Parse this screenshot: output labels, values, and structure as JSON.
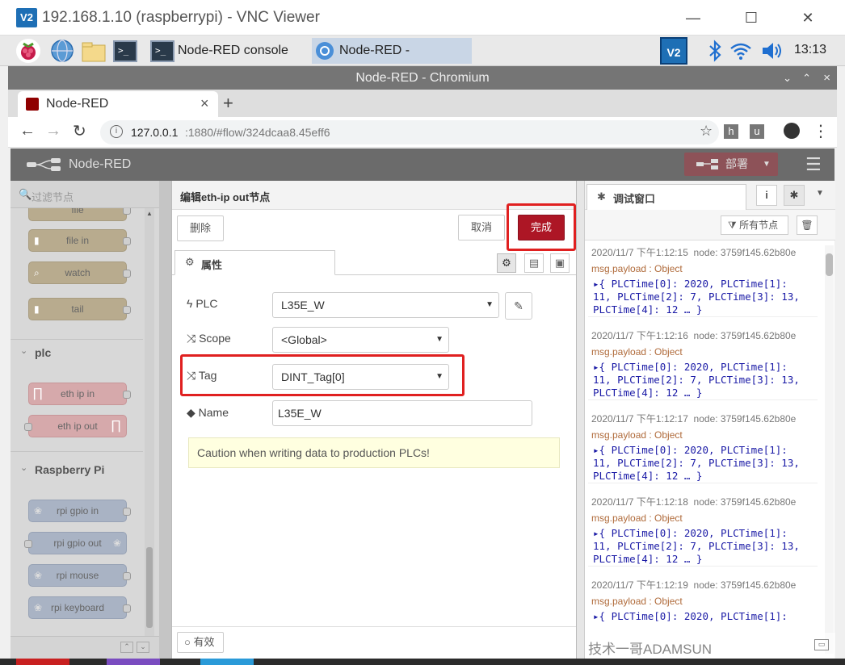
{
  "vnc": {
    "logo": "V2",
    "title": "192.168.1.10 (raspberrypi) - VNC Viewer",
    "minimize": "—",
    "maximize": "☐",
    "close": "✕"
  },
  "taskbar": {
    "tasks": [
      "Node-RED console",
      "Node-RED - Chromium"
    ],
    "tray_vnc": "V2",
    "clock": "13:13"
  },
  "chrome": {
    "window_title": "Node-RED - Chromium",
    "tab_title": "Node-RED",
    "tab_close": "×",
    "new_tab": "+",
    "url_host": "127.0.0.1",
    "url_rest": ":1880/#flow/324dcaa8.45eff6",
    "ext_h": "h",
    "ext_u": "u",
    "win_controls": [
      "⌄",
      "⌃",
      "×"
    ]
  },
  "nodered": {
    "brand": "Node-RED",
    "deploy_label": "部署",
    "filter_placeholder": "过滤节点",
    "palette": {
      "storage_nodes": [
        "file",
        "file in",
        "watch",
        "tail"
      ],
      "plc_category": "plc",
      "plc_nodes": [
        "eth ip in",
        "eth ip out"
      ],
      "rpi_category": "Raspberry Pi",
      "rpi_nodes": [
        "rpi gpio in",
        "rpi gpio out",
        "rpi mouse",
        "rpi keyboard"
      ]
    },
    "editor": {
      "title": "编辑eth-ip out节点",
      "delete_label": "删除",
      "cancel_label": "取消",
      "done_label": "完成",
      "tab_properties": "属性",
      "fields": {
        "plc_label": "PLC",
        "plc_value": "L35E_W",
        "scope_label": "Scope",
        "scope_value": "<Global>",
        "tag_label": "Tag",
        "tag_value": "DINT_Tag[0]",
        "name_label": "Name",
        "name_value": "L35E_W"
      },
      "caution": "Caution when writing data to production PLCs!",
      "enabled_label": "有效"
    },
    "debug": {
      "tab_title": "调试窗口",
      "filter_label": "所有节点",
      "messages": [
        {
          "time": "2020/11/7 下午1:12:15",
          "node": "node: 3759f145.62b80e",
          "topic": "msg.payload : Object",
          "lines": [
            "▸{ PLCTime[0]: 2020, PLCTime[1]:",
            "11, PLCTime[2]: 7, PLCTime[3]: 13,",
            "PLCTime[4]: 12 … }"
          ]
        },
        {
          "time": "2020/11/7 下午1:12:16",
          "node": "node: 3759f145.62b80e",
          "topic": "msg.payload : Object",
          "lines": [
            "▸{ PLCTime[0]: 2020, PLCTime[1]:",
            "11, PLCTime[2]: 7, PLCTime[3]: 13,",
            "PLCTime[4]: 12 … }"
          ]
        },
        {
          "time": "2020/11/7 下午1:12:17",
          "node": "node: 3759f145.62b80e",
          "topic": "msg.payload : Object",
          "lines": [
            "▸{ PLCTime[0]: 2020, PLCTime[1]:",
            "11, PLCTime[2]: 7, PLCTime[3]: 13,",
            "PLCTime[4]: 12 … }"
          ]
        },
        {
          "time": "2020/11/7 下午1:12:18",
          "node": "node: 3759f145.62b80e",
          "topic": "msg.payload : Object",
          "lines": [
            "▸{ PLCTime[0]: 2020, PLCTime[1]:",
            "11, PLCTime[2]: 7, PLCTime[3]: 13,",
            "PLCTime[4]: 12 … }"
          ]
        },
        {
          "time": "2020/11/7 下午1:12:19",
          "node": "node: 3759f145.62b80e",
          "topic": "msg.payload : Object",
          "lines": [
            "▸{ PLCTime[0]: 2020, PLCTime[1]:"
          ]
        }
      ]
    }
  },
  "watermark": "技术一哥ADAMSUN",
  "colors": {
    "done": "#ad1625",
    "header": "#6b6b6b",
    "deploy": "#8d5258",
    "highlight": "#e02020"
  }
}
